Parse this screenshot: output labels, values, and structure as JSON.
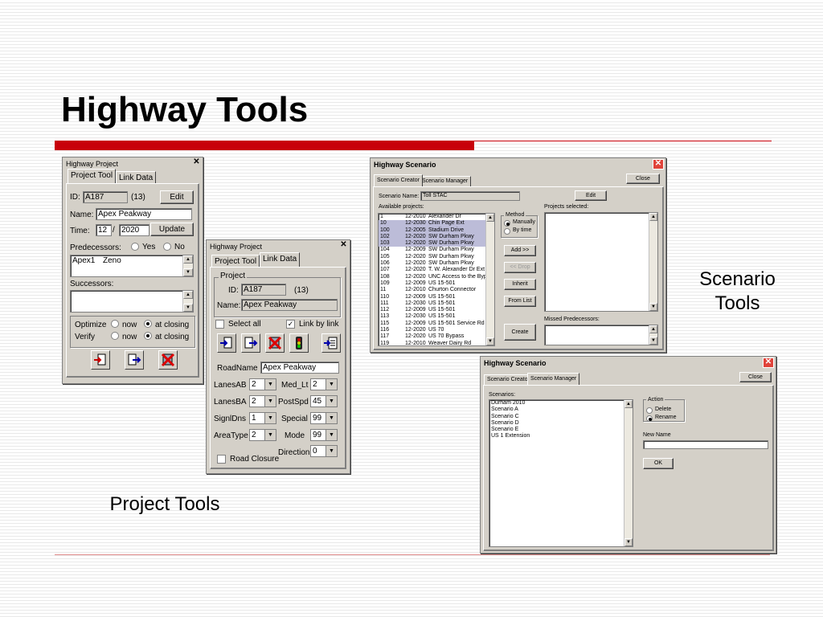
{
  "slide": {
    "title": "Highway Tools",
    "caption_project": "Project Tools",
    "caption_scenario": "Scenario Tools"
  },
  "colors": {
    "accent_red": "#c8000a",
    "dialog_bg": "#d4d0c8",
    "titlebar_blue": "#0a246a"
  },
  "proj1": {
    "title": "Highway Project",
    "tab_project": "Project Tool",
    "tab_link": "Link Data",
    "id_label": "ID:",
    "id_value": "A187",
    "id_count": "(13)",
    "edit": "Edit",
    "name_label": "Name:",
    "name_value": "Apex Peakway",
    "time_label": "Time:",
    "time_month": "12",
    "time_sep": "/",
    "time_year": "2020",
    "update": "Update",
    "pred_label": "Predecessors:",
    "yes": "Yes",
    "no": "No",
    "pred_1": "Apex1",
    "pred_2": "Zeno",
    "succ_label": "Successors:",
    "optimize": "Optimize",
    "verify": "Verify",
    "now": "now",
    "at_closing": "at closing",
    "icons": [
      "add-link-icon",
      "select-link-icon",
      "delete-link-icon"
    ]
  },
  "proj2": {
    "title": "Highway Project",
    "tab_project": "Project Tool",
    "tab_link": "Link Data",
    "group": "Project",
    "id_label": "ID:",
    "id_value": "A187",
    "id_count": "(13)",
    "name_label": "Name:",
    "name_value": "Apex Peakway",
    "select_all": "Select all",
    "link_by_link": "Link by link",
    "roadname_label": "RoadName",
    "roadname_value": "Apex Peakway",
    "lanesab": "LanesAB",
    "lanesab_v": "2",
    "medlt": "Med_Lt",
    "medlt_v": "2",
    "lanesba": "LanesBA",
    "lanesba_v": "2",
    "postspd": "PostSpd",
    "postspd_v": "45",
    "signldns": "SignlDns",
    "signldns_v": "1",
    "special": "Special",
    "special_v": "99",
    "areatype": "AreaType",
    "areatype_v": "2",
    "mode": "Mode",
    "mode_v": "99",
    "direction": "Direction",
    "direction_v": "0",
    "road_closure": "Road Closure",
    "icons": [
      "add-link-icon",
      "select-link-icon",
      "delete-link-icon",
      "traffic-light-icon",
      "export-icon"
    ]
  },
  "scen1": {
    "title": "Highway Scenario",
    "tab_creator": "Scenario Creator",
    "tab_manager": "Scenario Manager",
    "close": "Close",
    "name_label": "Scenario Name:",
    "name_value": "Toll STAC",
    "edit": "Edit",
    "available_label": "Available projects:",
    "projects": [
      {
        "id": "1",
        "date": "12-2010",
        "name": "Alexander Dr",
        "sel": false
      },
      {
        "id": "10",
        "date": "12-2030",
        "name": "Chin Page Ext",
        "sel": true
      },
      {
        "id": "100",
        "date": "12-2005",
        "name": "Stadium Drive",
        "sel": true
      },
      {
        "id": "102",
        "date": "12-2020",
        "name": "SW Durham Pkwy",
        "sel": true
      },
      {
        "id": "103",
        "date": "12-2020",
        "name": "SW Durham Pkwy",
        "sel": true
      },
      {
        "id": "104",
        "date": "12-2009",
        "name": "SW Durham Pkwy",
        "sel": false
      },
      {
        "id": "105",
        "date": "12-2020",
        "name": "SW Durham Pkwy",
        "sel": false
      },
      {
        "id": "106",
        "date": "12-2020",
        "name": "SW Durham Pkwy",
        "sel": false
      },
      {
        "id": "107",
        "date": "12-2020",
        "name": "T. W. Alexander Dr Ext",
        "sel": false
      },
      {
        "id": "108",
        "date": "12-2020",
        "name": "UNC Access to the Bypa",
        "sel": false
      },
      {
        "id": "109",
        "date": "12-2009",
        "name": "US 15-501",
        "sel": false
      },
      {
        "id": "11",
        "date": "12-2010",
        "name": "Churton Connector",
        "sel": false
      },
      {
        "id": "110",
        "date": "12-2009",
        "name": "US 15-501",
        "sel": false
      },
      {
        "id": "111",
        "date": "12-2030",
        "name": "US 15-501",
        "sel": false
      },
      {
        "id": "112",
        "date": "12-2009",
        "name": "US 15-501",
        "sel": false
      },
      {
        "id": "113",
        "date": "12-2030",
        "name": "US 15-501",
        "sel": false
      },
      {
        "id": "115",
        "date": "12-2009",
        "name": "US 15-501 Service Rd",
        "sel": false
      },
      {
        "id": "116",
        "date": "12-2020",
        "name": "US 70",
        "sel": false
      },
      {
        "id": "117",
        "date": "12-2020",
        "name": "US 70 Bypass",
        "sel": false
      },
      {
        "id": "119",
        "date": "12-2010",
        "name": "Weaver Dairy Rd",
        "sel": false
      }
    ],
    "method": "Method",
    "manually": "Manually",
    "by_time": "By time",
    "add": "Add >>",
    "drop": "<< Drop",
    "inherit": "Inherit",
    "from_list": "From List",
    "create": "Create",
    "selected_label": "Projects selected:",
    "missed_label": "Missed Predecessors:"
  },
  "scen2": {
    "title": "Highway Scenario",
    "tab_creator": "Scenario Creator",
    "tab_manager": "Scenario Manager",
    "close": "Close",
    "scenarios_label": "Scenarios:",
    "scenarios": [
      "Durham 2010",
      "Scenario A",
      "Scenario C",
      "Scenario D",
      "Scenario E",
      "US 1 Extension"
    ],
    "action": "Action",
    "delete": "Delete",
    "rename": "Rename",
    "new_name": "New Name",
    "ok": "OK"
  }
}
